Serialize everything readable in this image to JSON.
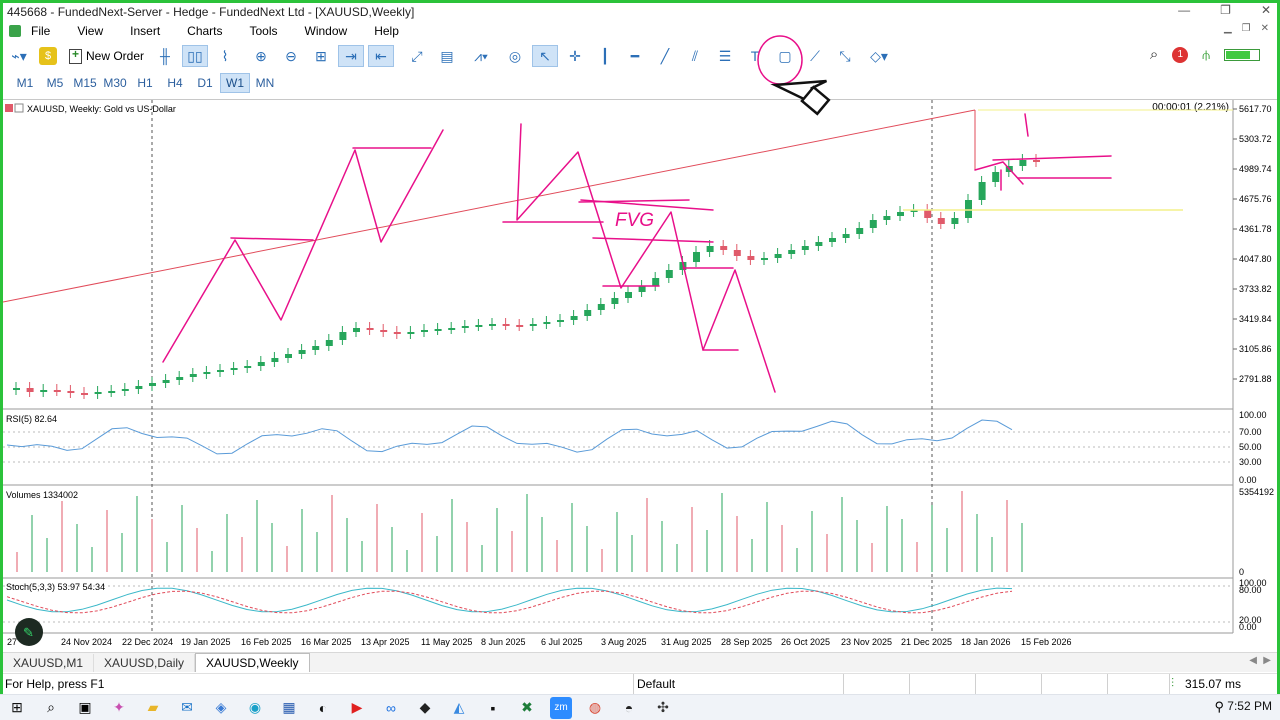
{
  "window": {
    "title": "445668 - FundedNext-Server - Hedge - FundedNext Ltd - [XAUUSD,Weekly]",
    "controls": [
      "—",
      "❐",
      "✕"
    ]
  },
  "menu": [
    "File",
    "View",
    "Insert",
    "Charts",
    "Tools",
    "Window",
    "Help"
  ],
  "toolbar": {
    "new_order": "New Order"
  },
  "timeframes": [
    {
      "label": "M1",
      "active": false
    },
    {
      "label": "M5",
      "active": false
    },
    {
      "label": "M15",
      "active": false
    },
    {
      "label": "M30",
      "active": false
    },
    {
      "label": "H1",
      "active": false
    },
    {
      "label": "H4",
      "active": false
    },
    {
      "label": "D1",
      "active": false
    },
    {
      "label": "W1",
      "active": true
    },
    {
      "label": "MN",
      "active": false
    }
  ],
  "notifications_count": "1",
  "chart": {
    "symbol_label": "XAUUSD, Weekly: Gold vs US-Dollar",
    "timer": "00:00:01 (2.21%)",
    "price_ticks": [
      "5617.70",
      "5303.72",
      "4989.74",
      "4675.76",
      "4361.78",
      "4047.80",
      "3733.82",
      "3419.84",
      "3105.86",
      "2791.88"
    ],
    "rsi_label": "RSI(5) 82.64",
    "rsi_ticks": [
      "100.00",
      "70.00",
      "50.00",
      "30.00",
      "0.00"
    ],
    "volumes_label": "Volumes 1334002",
    "volume_ticks": [
      "5354192",
      "0"
    ],
    "stoch_label": "Stoch(5,3,3) 53.97 54.34",
    "stoch_ticks": [
      "100.00",
      "80.00",
      "20.00",
      "0.00"
    ],
    "date_ticks": [
      "27",
      "24 Nov 2024",
      "22 Dec 2024",
      "19 Jan 2025",
      "16 Feb 2025",
      "16 Mar 2025",
      "13 Apr 2025",
      "11 May 2025",
      "8 Jun 2025",
      "6 Jul 2025",
      "3 Aug 2025",
      "31 Aug 2025",
      "28 Sep 2025",
      "26 Oct 2025",
      "23 Nov 2025",
      "21 Dec 2025",
      "18 Jan 2026",
      "15 Feb 2026"
    ],
    "annotation_text": "FVG",
    "colors": {
      "bull": "#26a65b",
      "bear": "#e05a6a",
      "pen": "#e8108a",
      "rsi": "#5a9bd8",
      "trend": "#e14b5a"
    }
  },
  "tabs": [
    {
      "label": "XAUUSD,M1",
      "active": false
    },
    {
      "label": "XAUUSD,Daily",
      "active": false
    },
    {
      "label": "XAUUSD,Weekly",
      "active": true
    }
  ],
  "status": {
    "help": "For Help, press F1",
    "profile": "Default",
    "ping": "315.07 ms"
  },
  "taskbar": {
    "time": "7:52 PM"
  }
}
